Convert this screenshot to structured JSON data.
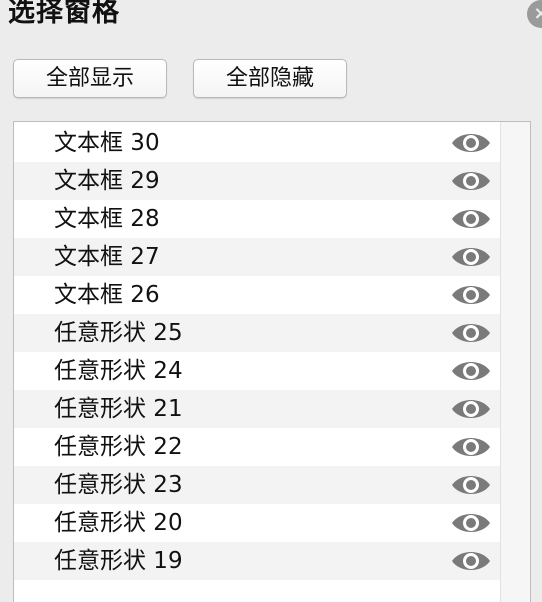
{
  "pane": {
    "title": "选择窗格",
    "close_symbol": "×"
  },
  "toolbar": {
    "show_all_label": "全部显示",
    "hide_all_label": "全部隐藏"
  },
  "items": [
    {
      "label": "文本框 30",
      "icon": "eye-icon",
      "visible": true
    },
    {
      "label": "文本框 29",
      "icon": "eye-icon",
      "visible": true
    },
    {
      "label": "文本框 28",
      "icon": "eye-icon",
      "visible": true
    },
    {
      "label": "文本框 27",
      "icon": "eye-icon",
      "visible": true
    },
    {
      "label": "文本框 26",
      "icon": "eye-icon",
      "visible": true
    },
    {
      "label": "任意形状 25",
      "icon": "eye-icon",
      "visible": true
    },
    {
      "label": "任意形状 24",
      "icon": "eye-icon",
      "visible": true
    },
    {
      "label": "任意形状 21",
      "icon": "eye-icon",
      "visible": true
    },
    {
      "label": "任意形状 22",
      "icon": "eye-icon",
      "visible": true
    },
    {
      "label": "任意形状 23",
      "icon": "eye-icon",
      "visible": true
    },
    {
      "label": "任意形状 20",
      "icon": "eye-icon",
      "visible": true
    },
    {
      "label": "任意形状 19",
      "icon": "eye-icon",
      "visible": true
    }
  ],
  "colors": {
    "panel_bg": "#ececec",
    "row_alt_bg": "#f3f3f3",
    "eye_icon": "#7a7a7a"
  }
}
